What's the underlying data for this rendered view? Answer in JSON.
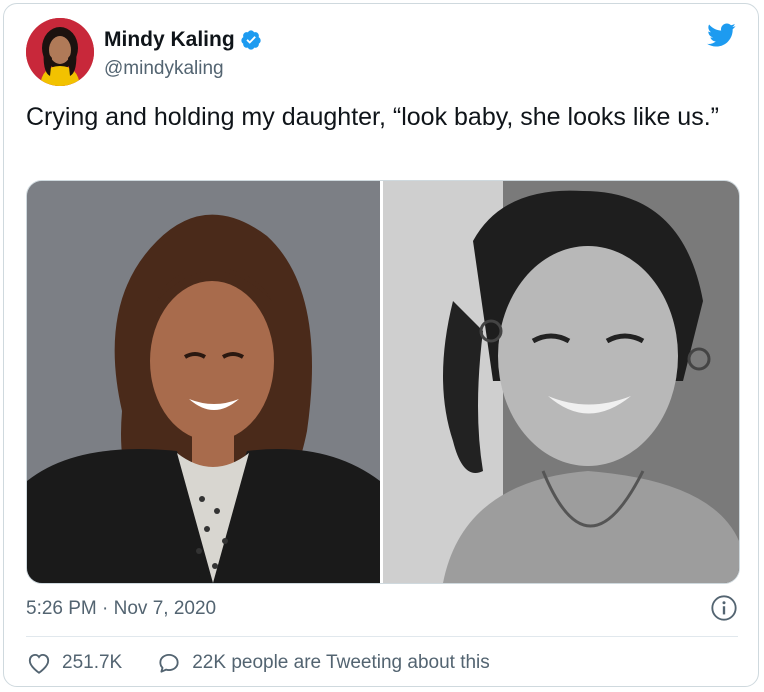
{
  "author": {
    "name": "Mindy Kaling",
    "handle": "@mindykaling",
    "verified": true
  },
  "tweet": {
    "text": "Crying and holding my daughter, “look baby, she looks like us.”",
    "timestamp": "5:26 PM · Nov 7, 2020"
  },
  "engagement": {
    "likes": "251.7K",
    "conversation": "22K people are Tweeting about this"
  },
  "colors": {
    "twitter_blue": "#1d9bf0",
    "text_primary": "#0f1419",
    "text_secondary": "#536471"
  },
  "icons": {
    "verified": "verified-badge-icon",
    "brand": "twitter-bird-icon",
    "info": "info-icon",
    "like": "heart-icon",
    "reply": "speech-bubble-icon"
  }
}
